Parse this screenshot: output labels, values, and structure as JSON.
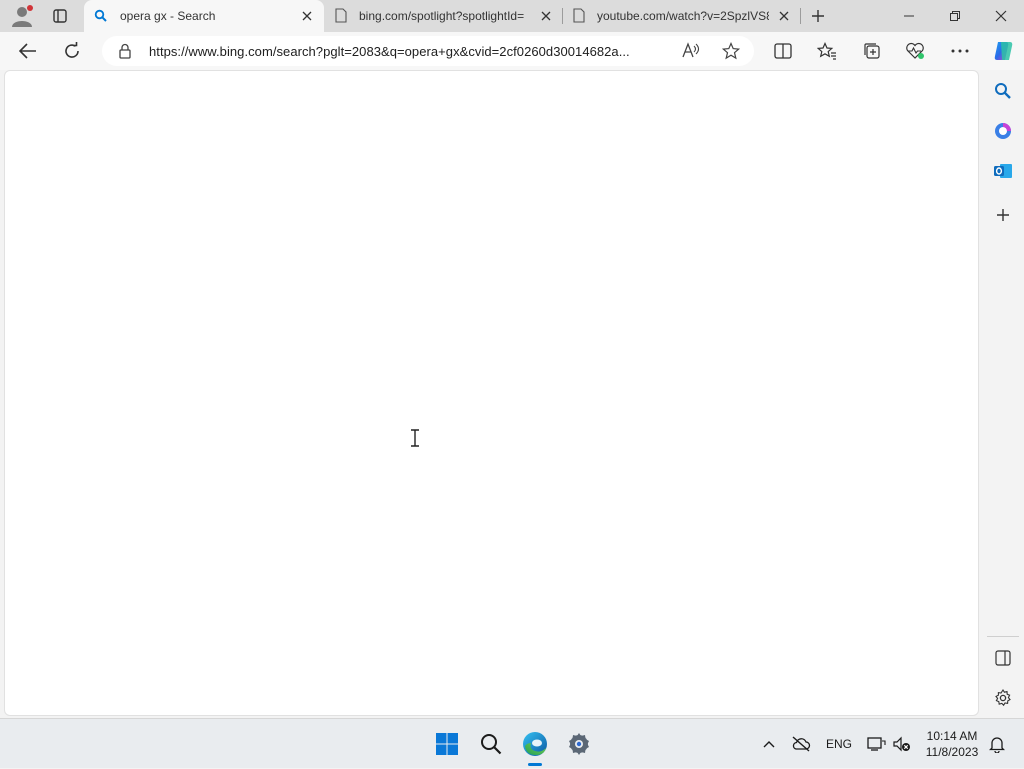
{
  "tabs": [
    {
      "title": "opera gx - Search",
      "active": true,
      "icon": "search-icon"
    },
    {
      "title": "bing.com/spotlight?spotlightId=",
      "active": false,
      "icon": "page-icon"
    },
    {
      "title": "youtube.com/watch?v=2SpzlVS8",
      "active": false,
      "icon": "page-icon"
    }
  ],
  "address": {
    "url": "https://www.bing.com/search?pglt=2083&q=opera+gx&cvid=2cf0260d30014682a..."
  },
  "taskbar": {
    "language": "ENG",
    "time": "10:14 AM",
    "date": "11/8/2023"
  },
  "colors": {
    "accent_blue": "#0078d4",
    "edge_green": "#30c46b",
    "outlook_blue": "#0f6cbd"
  }
}
